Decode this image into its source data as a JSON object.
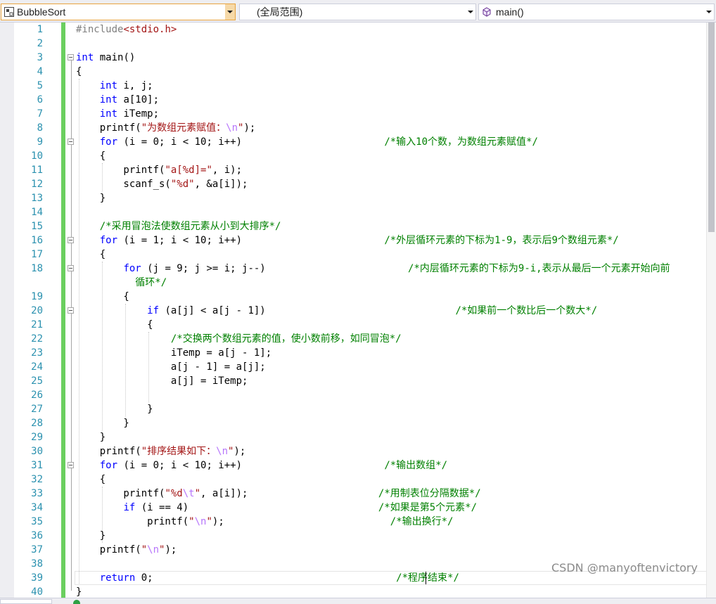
{
  "navbar": {
    "project": {
      "label": "BubbleSort",
      "icon": "project-icon"
    },
    "scope": {
      "label": "(全局范围)"
    },
    "member": {
      "label": "main()",
      "icon": "function-cube-icon"
    }
  },
  "line_numbers": [
    "1",
    "2",
    "3",
    "4",
    "5",
    "6",
    "7",
    "8",
    "9",
    "10",
    "11",
    "12",
    "13",
    "14",
    "15",
    "16",
    "17",
    "18",
    "19",
    "20",
    "21",
    "22",
    "23",
    "24",
    "25",
    "26",
    "27",
    "28",
    "29",
    "30",
    "31",
    "32",
    "33",
    "34",
    "35",
    "36",
    "37",
    "38",
    "39",
    "40"
  ],
  "code": [
    [
      [
        "pp",
        "#include"
      ],
      [
        "str",
        "<stdio.h>"
      ]
    ],
    [],
    [
      [
        "kw",
        "int"
      ],
      [
        "t",
        " main()"
      ]
    ],
    [
      [
        "t",
        "{"
      ]
    ],
    [
      [
        "t",
        "    "
      ],
      [
        "kw",
        "int"
      ],
      [
        "t",
        " i, j;"
      ]
    ],
    [
      [
        "t",
        "    "
      ],
      [
        "kw",
        "int"
      ],
      [
        "t",
        " a[10];"
      ]
    ],
    [
      [
        "t",
        "    "
      ],
      [
        "kw",
        "int"
      ],
      [
        "t",
        " iTemp;"
      ]
    ],
    [
      [
        "t",
        "    printf("
      ],
      [
        "str",
        "\"为数组元素赋值："
      ],
      [
        "esc",
        "\\n"
      ],
      [
        "str",
        "\""
      ],
      [
        "t",
        ");"
      ]
    ],
    [
      [
        "t",
        "    "
      ],
      [
        "kw",
        "for"
      ],
      [
        "t",
        " (i = 0; i < 10; i++)                        "
      ],
      [
        "cm",
        "/*输入10个数，为数组元素赋值*/"
      ]
    ],
    [
      [
        "t",
        "    {"
      ]
    ],
    [
      [
        "t",
        "        printf("
      ],
      [
        "str",
        "\"a[%d]=\""
      ],
      [
        "t",
        ", i);"
      ]
    ],
    [
      [
        "t",
        "        scanf_s("
      ],
      [
        "str",
        "\"%d\""
      ],
      [
        "t",
        ", &a[i]);"
      ]
    ],
    [
      [
        "t",
        "    }"
      ]
    ],
    [],
    [
      [
        "t",
        "    "
      ],
      [
        "cm",
        "/*采用冒泡法使数组元素从小到大排序*/"
      ]
    ],
    [
      [
        "t",
        "    "
      ],
      [
        "kw",
        "for"
      ],
      [
        "t",
        " (i = 1; i < 10; i++)                        "
      ],
      [
        "cm",
        "/*外层循环元素的下标为1-9，表示后9个数组元素*/"
      ]
    ],
    [
      [
        "t",
        "    {"
      ]
    ],
    [
      [
        "t",
        "        "
      ],
      [
        "kw",
        "for"
      ],
      [
        "t",
        " (j = 9; j >= i; j--)                        "
      ],
      [
        "cm",
        "/*内层循环元素的下标为9-i,表示从最后一个元素开始向前"
      ]
    ],
    [
      [
        "t",
        "          "
      ],
      [
        "cm",
        "循环*/"
      ]
    ],
    [
      [
        "t",
        "        {"
      ]
    ],
    [
      [
        "t",
        "            "
      ],
      [
        "kw",
        "if"
      ],
      [
        "t",
        " (a[j] < a[j - 1])                                "
      ],
      [
        "cm",
        "/*如果前一个数比后一个数大*/"
      ]
    ],
    [
      [
        "t",
        "            {"
      ]
    ],
    [
      [
        "t",
        "                "
      ],
      [
        "cm",
        "/*交换两个数组元素的值，使小数前移，如同冒泡*/"
      ]
    ],
    [
      [
        "t",
        "                iTemp = a[j - 1];"
      ]
    ],
    [
      [
        "t",
        "                a[j - 1] = a[j];"
      ]
    ],
    [
      [
        "t",
        "                a[j] = iTemp;"
      ]
    ],
    [],
    [
      [
        "t",
        "            }"
      ]
    ],
    [
      [
        "t",
        "        }"
      ]
    ],
    [
      [
        "t",
        "    }"
      ]
    ],
    [
      [
        "t",
        "    printf("
      ],
      [
        "str",
        "\"排序结果如下："
      ],
      [
        "esc",
        "\\n"
      ],
      [
        "str",
        "\""
      ],
      [
        "t",
        ");"
      ]
    ],
    [
      [
        "t",
        "    "
      ],
      [
        "kw",
        "for"
      ],
      [
        "t",
        " (i = 0; i < 10; i++)                        "
      ],
      [
        "cm",
        "/*输出数组*/"
      ]
    ],
    [
      [
        "t",
        "    {"
      ]
    ],
    [
      [
        "t",
        "        printf("
      ],
      [
        "str",
        "\"%d"
      ],
      [
        "esc",
        "\\t"
      ],
      [
        "str",
        "\""
      ],
      [
        "t",
        ", a[i]);                      "
      ],
      [
        "cm",
        "/*用制表位分隔数据*/"
      ]
    ],
    [
      [
        "t",
        "        "
      ],
      [
        "kw",
        "if"
      ],
      [
        "t",
        " (i == 4)                                "
      ],
      [
        "cm",
        "/*如果是第5个元素*/"
      ]
    ],
    [
      [
        "t",
        "            printf("
      ],
      [
        "str",
        "\""
      ],
      [
        "esc",
        "\\n"
      ],
      [
        "str",
        "\""
      ],
      [
        "t",
        ");                            "
      ],
      [
        "cm",
        "/*输出换行*/"
      ]
    ],
    [
      [
        "t",
        "    }"
      ]
    ],
    [
      [
        "t",
        "    printf("
      ],
      [
        "str",
        "\""
      ],
      [
        "esc",
        "\\n"
      ],
      [
        "str",
        "\""
      ],
      [
        "t",
        ");"
      ]
    ],
    [],
    [
      [
        "t",
        "    "
      ],
      [
        "kw",
        "return"
      ],
      [
        "t",
        " 0;                                         "
      ],
      [
        "cm",
        "/*程序结束*/"
      ]
    ],
    [
      [
        "t",
        "}"
      ]
    ]
  ],
  "watermark": "CSDN @manyoftenvictory",
  "colors": {
    "keyword": "#0000ff",
    "string": "#a31515",
    "escape": "#b776fb",
    "comment": "#008000",
    "line_number": "#2b91af",
    "change_bar": "#6bcf5f"
  }
}
